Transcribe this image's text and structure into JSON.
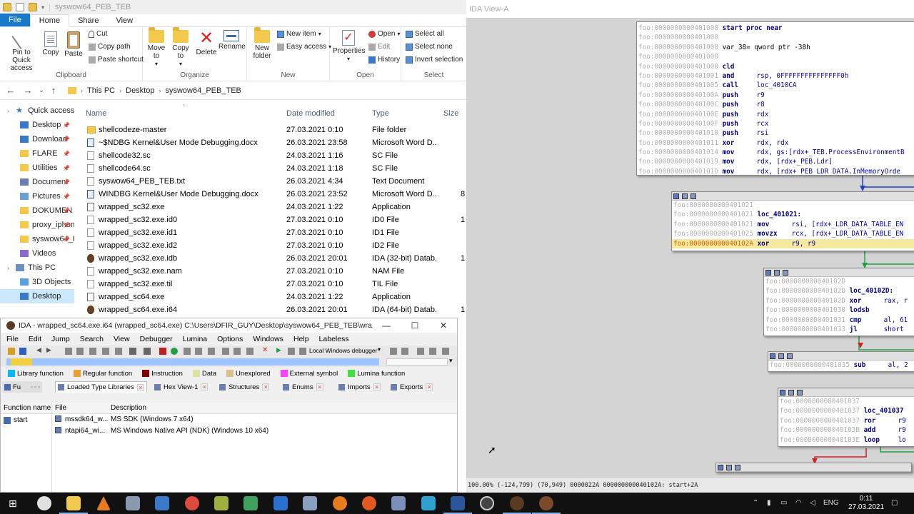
{
  "explorer": {
    "window_title": "syswow64_PEB_TEB",
    "tabs": [
      "File",
      "Home",
      "Share",
      "View"
    ],
    "ribbon": {
      "clipboard": {
        "pin": "Pin to Quick access",
        "copy": "Copy",
        "paste": "Paste",
        "cut": "Cut",
        "copy_path": "Copy path",
        "paste_shortcut": "Paste shortcut",
        "label": "Clipboard"
      },
      "organize": {
        "move_to": "Move to",
        "copy_to": "Copy to",
        "delete": "Delete",
        "rename": "Rename",
        "label": "Organize"
      },
      "new": {
        "new_folder": "New folder",
        "new_item": "New item",
        "easy_access": "Easy access",
        "label": "New"
      },
      "open": {
        "properties": "Properties",
        "open": "Open",
        "edit": "Edit",
        "history": "History",
        "label": "Open"
      },
      "select": {
        "select_all": "Select all",
        "select_none": "Select none",
        "invert": "Invert selection",
        "label": "Select"
      }
    },
    "breadcrumb": [
      "This PC",
      "Desktop",
      "syswow64_PEB_TEB"
    ],
    "nav": [
      {
        "label": "Quick access",
        "pinned": false
      },
      {
        "label": "Desktop",
        "pinned": true
      },
      {
        "label": "Download",
        "pinned": true
      },
      {
        "label": "FLARE",
        "pinned": true
      },
      {
        "label": "Utilities",
        "pinned": true
      },
      {
        "label": "Document",
        "pinned": true
      },
      {
        "label": "Pictures",
        "pinned": true
      },
      {
        "label": "DOKUMEN",
        "pinned": true
      },
      {
        "label": "proxy_iphon",
        "pinned": true
      },
      {
        "label": "syswow64_PE",
        "pinned": true
      },
      {
        "label": "Videos",
        "pinned": false
      },
      {
        "label": "This PC",
        "pinned": false
      },
      {
        "label": "3D Objects",
        "pinned": false
      },
      {
        "label": "Desktop",
        "pinned": false
      }
    ],
    "columns": {
      "name": "Name",
      "date": "Date modified",
      "type": "Type",
      "size": "Size"
    },
    "files": [
      {
        "name": "shellcodeze-master",
        "date": "27.03.2021 0:10",
        "type": "File folder",
        "size": "",
        "icon": "folder"
      },
      {
        "name": "~$NDBG Kernel&User Mode Debugging.docx",
        "date": "26.03.2021 23:58",
        "type": "Microsoft Word D...",
        "size": "",
        "icon": "word"
      },
      {
        "name": "shellcode32.sc",
        "date": "24.03.2021 1:16",
        "type": "SC File",
        "size": "",
        "icon": "file"
      },
      {
        "name": "shellcode64.sc",
        "date": "24.03.2021 1:18",
        "type": "SC File",
        "size": "",
        "icon": "file"
      },
      {
        "name": "syswow64_PEB_TEB.txt",
        "date": "26.03.2021 4:34",
        "type": "Text Document",
        "size": "",
        "icon": "file"
      },
      {
        "name": "WINDBG Kernel&User Mode Debugging.docx",
        "date": "26.03.2021 23:52",
        "type": "Microsoft Word D...",
        "size": "8",
        "icon": "word"
      },
      {
        "name": "wrapped_sc32.exe",
        "date": "24.03.2021 1:22",
        "type": "Application",
        "size": "",
        "icon": "exe"
      },
      {
        "name": "wrapped_sc32.exe.id0",
        "date": "27.03.2021 0:10",
        "type": "ID0 File",
        "size": "1",
        "icon": "file"
      },
      {
        "name": "wrapped_sc32.exe.id1",
        "date": "27.03.2021 0:10",
        "type": "ID1 File",
        "size": "",
        "icon": "file"
      },
      {
        "name": "wrapped_sc32.exe.id2",
        "date": "27.03.2021 0:10",
        "type": "ID2 File",
        "size": "",
        "icon": "file"
      },
      {
        "name": "wrapped_sc32.exe.idb",
        "date": "26.03.2021 20:01",
        "type": "IDA (32-bit) Datab...",
        "size": "1",
        "icon": "ida"
      },
      {
        "name": "wrapped_sc32.exe.nam",
        "date": "27.03.2021 0:10",
        "type": "NAM File",
        "size": "",
        "icon": "file"
      },
      {
        "name": "wrapped_sc32.exe.til",
        "date": "27.03.2021 0:10",
        "type": "TIL File",
        "size": "",
        "icon": "file"
      },
      {
        "name": "wrapped_sc64.exe",
        "date": "24.03.2021 1:22",
        "type": "Application",
        "size": "",
        "icon": "exe"
      },
      {
        "name": "wrapped_sc64.exe.i64",
        "date": "26.03.2021 20:01",
        "type": "IDA (64-bit) Datab...",
        "size": "1",
        "icon": "ida"
      }
    ]
  },
  "ida_small": {
    "title": "IDA - wrapped_sc64.exe.i64 (wrapped_sc64.exe) C:\\Users\\DFIR_GUY\\Desktop\\syswow64_PEB_TEB\\wrapped_sc6...",
    "menu": [
      "File",
      "Edit",
      "Jump",
      "Search",
      "View",
      "Debugger",
      "Lumina",
      "Options",
      "Windows",
      "Help",
      "Labeless"
    ],
    "debugger_select": "Local Windows debugger",
    "legend": [
      {
        "label": "Library function",
        "color": "#00b8ff"
      },
      {
        "label": "Regular function",
        "color": "#e8a030"
      },
      {
        "label": "Instruction",
        "color": "#800000"
      },
      {
        "label": "Data",
        "color": "#e0e0a0"
      },
      {
        "label": "Unexplored",
        "color": "#d8c088"
      },
      {
        "label": "External symbol",
        "color": "#ff40ff"
      },
      {
        "label": "Lumina function",
        "color": "#40e040"
      }
    ],
    "func_tab": "Fu",
    "tabs": [
      "Loaded Type Libraries",
      "Hex View-1",
      "Structures",
      "Enums",
      "Imports",
      "Exports"
    ],
    "function_name_header": "Function name",
    "functions": [
      "start"
    ],
    "til_headers": {
      "file": "File",
      "description": "Description"
    },
    "til_rows": [
      {
        "file": "mssdk64_w...",
        "description": "MS SDK (Windows 7 x64)"
      },
      {
        "file": "ntapi64_wi...",
        "description": "MS Windows Native API (NDK) (Windows 10 x64)"
      }
    ]
  },
  "ida_graph": {
    "title": "IDA View-A",
    "block1": [
      {
        "addr": "foo:0000000000401000",
        "op": "",
        "args": "start proc near",
        "kind": "label"
      },
      {
        "addr": "foo:0000000000401000",
        "op": "",
        "args": "",
        "kind": "blank"
      },
      {
        "addr": "foo:0000000000401000",
        "op": "",
        "args": "var_38= qword ptr -38h",
        "kind": "var"
      },
      {
        "addr": "foo:0000000000401000",
        "op": "",
        "args": "",
        "kind": "blank"
      },
      {
        "addr": "foo:0000000000401000",
        "op": "cld",
        "args": "",
        "kind": "ins"
      },
      {
        "addr": "foo:0000000000401001",
        "op": "and",
        "args": "rsp, 0FFFFFFFFFFFFFFF0h",
        "kind": "ins"
      },
      {
        "addr": "foo:0000000000401005",
        "op": "call",
        "args": "loc_4010CA",
        "kind": "ins"
      },
      {
        "addr": "foo:000000000040100A",
        "op": "push",
        "args": "r9",
        "kind": "ins"
      },
      {
        "addr": "foo:000000000040100C",
        "op": "push",
        "args": "r8",
        "kind": "ins"
      },
      {
        "addr": "foo:000000000040100E",
        "op": "push",
        "args": "rdx",
        "kind": "ins"
      },
      {
        "addr": "foo:000000000040100F",
        "op": "push",
        "args": "rcx",
        "kind": "ins"
      },
      {
        "addr": "foo:0000000000401010",
        "op": "push",
        "args": "rsi",
        "kind": "ins"
      },
      {
        "addr": "foo:0000000000401011",
        "op": "xor",
        "args": "rdx, rdx",
        "kind": "ins"
      },
      {
        "addr": "foo:0000000000401014",
        "op": "mov",
        "args": "rdx, gs:[rdx+_TEB.ProcessEnvironmentB",
        "kind": "ins"
      },
      {
        "addr": "foo:0000000000401019",
        "op": "mov",
        "args": "rdx, [rdx+_PEB.Ldr]",
        "kind": "ins"
      },
      {
        "addr": "foo:000000000040101D",
        "op": "mov",
        "args": "rdx, [rdx+_PEB_LDR_DATA.InMemoryOrde",
        "kind": "ins"
      }
    ],
    "block2": [
      {
        "addr": "foo:0000000000401021",
        "op": "",
        "args": "",
        "kind": "blank"
      },
      {
        "addr": "foo:0000000000401021",
        "op": "",
        "args": "loc_401021:",
        "kind": "label"
      },
      {
        "addr": "foo:0000000000401021",
        "op": "mov",
        "args": "rsi, [rdx+_LDR_DATA_TABLE_EN",
        "kind": "ins"
      },
      {
        "addr": "foo:0000000000401025",
        "op": "movzx",
        "args": "rcx, [rdx+_LDR_DATA_TABLE_EN",
        "kind": "ins"
      },
      {
        "addr": "foo:000000000040102A",
        "op": "xor",
        "args": "r9, r9",
        "kind": "hl"
      }
    ],
    "block3": [
      {
        "addr": "foo:000000000040102D",
        "op": "",
        "args": "",
        "kind": "blank"
      },
      {
        "addr": "foo:000000000040102D",
        "op": "",
        "args": "loc_40102D:",
        "kind": "label"
      },
      {
        "addr": "foo:000000000040102D",
        "op": "xor",
        "args": "rax, r",
        "kind": "ins"
      },
      {
        "addr": "foo:0000000000401030",
        "op": "lodsb",
        "args": "",
        "kind": "ins"
      },
      {
        "addr": "foo:0000000000401031",
        "op": "cmp",
        "args": "al, 61",
        "kind": "ins"
      },
      {
        "addr": "foo:0000000000401033",
        "op": "jl",
        "args": "short",
        "kind": "ins"
      }
    ],
    "block4": [
      {
        "addr": "foo:0000000000401035",
        "op": "sub",
        "args": "al, 2",
        "kind": "ins"
      }
    ],
    "block5": [
      {
        "addr": "foo:0000000000401037",
        "op": "",
        "args": "",
        "kind": "blank"
      },
      {
        "addr": "foo:0000000000401037",
        "op": "",
        "args": "loc_401037",
        "kind": "label"
      },
      {
        "addr": "foo:0000000000401037",
        "op": "ror",
        "args": "r9",
        "kind": "ins"
      },
      {
        "addr": "foo:000000000040103B",
        "op": "add",
        "args": "r9",
        "kind": "ins"
      },
      {
        "addr": "foo:000000000040103E",
        "op": "loop",
        "args": "lo",
        "kind": "ins"
      }
    ],
    "status": "100.00% (-124,799) (70,949) 0000022A 000000000040102A: start+2A"
  },
  "taskbar": {
    "lang": "ENG",
    "time": "0:11",
    "date": "27.03.2021"
  }
}
